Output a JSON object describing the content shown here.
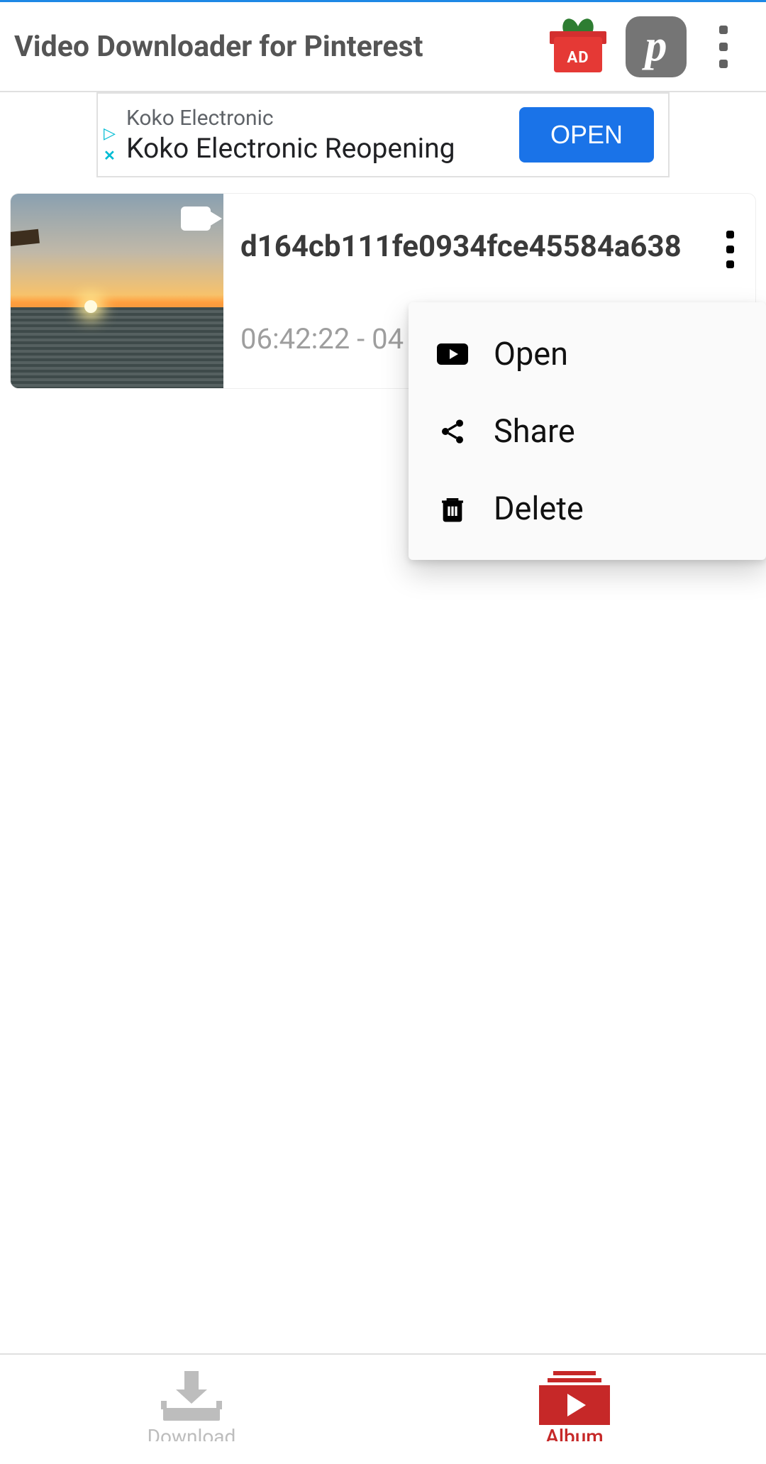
{
  "header": {
    "title": "Video Downloader for Pinterest",
    "ad_gift_label": "AD"
  },
  "ad": {
    "advertiser": "Koko Electronic",
    "headline": "Koko Electronic Reopening",
    "cta": "OPEN"
  },
  "item": {
    "filename": "d164cb111fe0934fce45584a638",
    "timestamp": "06:42:22 - 04"
  },
  "menu": {
    "open": "Open",
    "share": "Share",
    "delete": "Delete"
  },
  "nav": {
    "download": "Download",
    "album": "Album"
  }
}
